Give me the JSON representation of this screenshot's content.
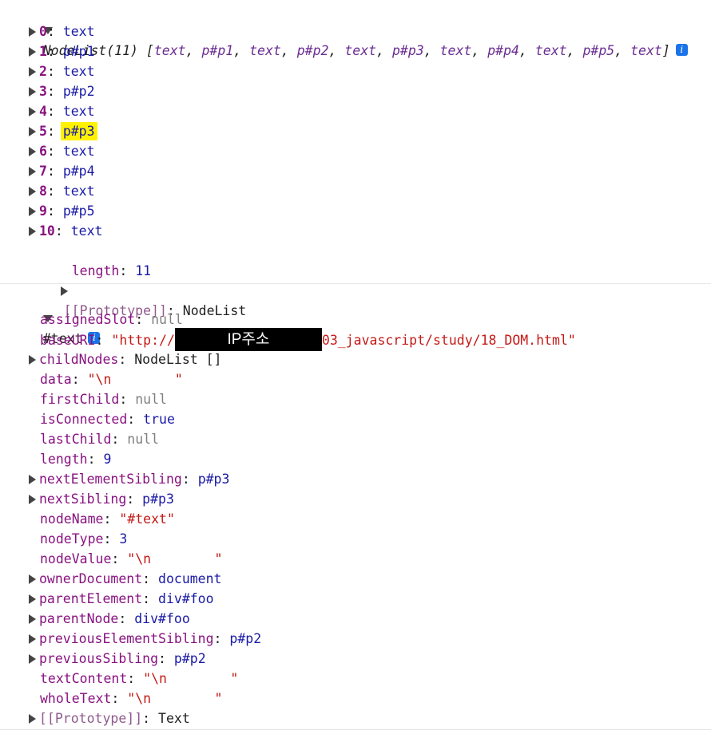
{
  "nodelist": {
    "header": {
      "prefix": "NodeList(11) [",
      "suffix": "]"
    },
    "preview_items": [
      "text",
      "p#p1",
      "text",
      "p#p2",
      "text",
      "p#p3",
      "text",
      "p#p4",
      "text",
      "p#p5",
      "text"
    ],
    "entries": [
      {
        "key": "0",
        "value": "text"
      },
      {
        "key": "1",
        "value": "p#p1"
      },
      {
        "key": "2",
        "value": "text"
      },
      {
        "key": "3",
        "value": "p#p2"
      },
      {
        "key": "4",
        "value": "text"
      },
      {
        "key": "5",
        "value": "p#p3",
        "highlighted": true
      },
      {
        "key": "6",
        "value": "text"
      },
      {
        "key": "7",
        "value": "p#p4"
      },
      {
        "key": "8",
        "value": "text"
      },
      {
        "key": "9",
        "value": "p#p5"
      },
      {
        "key": "10",
        "value": "text"
      }
    ],
    "length_key": "length",
    "length_value": "11",
    "proto_key": "[[Prototype]]",
    "proto_value": "NodeList"
  },
  "textnode": {
    "header": "#text",
    "props": [
      {
        "key": "assignedSlot",
        "value": "null",
        "type": "null"
      },
      {
        "key": "baseURI",
        "value_prefix": "\"http://",
        "redacted_label": "IP주소",
        "value_suffix": "03_javascript/study/18_DOM.html\"",
        "type": "url"
      },
      {
        "key": "childNodes",
        "value": "NodeList []",
        "type": "obj",
        "expandable": true
      },
      {
        "key": "data",
        "value": "\"\\n        \"",
        "type": "str"
      },
      {
        "key": "firstChild",
        "value": "null",
        "type": "null"
      },
      {
        "key": "isConnected",
        "value": "true",
        "type": "bool"
      },
      {
        "key": "lastChild",
        "value": "null",
        "type": "null"
      },
      {
        "key": "length",
        "value": "9",
        "type": "num"
      },
      {
        "key": "nextElementSibling",
        "value": "p#p3",
        "type": "node",
        "expandable": true
      },
      {
        "key": "nextSibling",
        "value": "p#p3",
        "type": "node",
        "expandable": true
      },
      {
        "key": "nodeName",
        "value": "\"#text\"",
        "type": "str"
      },
      {
        "key": "nodeType",
        "value": "3",
        "type": "num"
      },
      {
        "key": "nodeValue",
        "value": "\"\\n        \"",
        "type": "str"
      },
      {
        "key": "ownerDocument",
        "value": "document",
        "type": "node",
        "expandable": true
      },
      {
        "key": "parentElement",
        "value": "div#foo",
        "type": "node",
        "expandable": true
      },
      {
        "key": "parentNode",
        "value": "div#foo",
        "type": "node",
        "expandable": true
      },
      {
        "key": "previousElementSibling",
        "value": "p#p2",
        "type": "node",
        "expandable": true
      },
      {
        "key": "previousSibling",
        "value": "p#p2",
        "type": "node",
        "expandable": true
      },
      {
        "key": "textContent",
        "value": "\"\\n        \"",
        "type": "str"
      },
      {
        "key": "wholeText",
        "value": "\"\\n        \"",
        "type": "str"
      },
      {
        "key": "[[Prototype]]",
        "value": "Text",
        "type": "obj",
        "expandable": true
      }
    ]
  },
  "icons": {
    "info": "i"
  }
}
